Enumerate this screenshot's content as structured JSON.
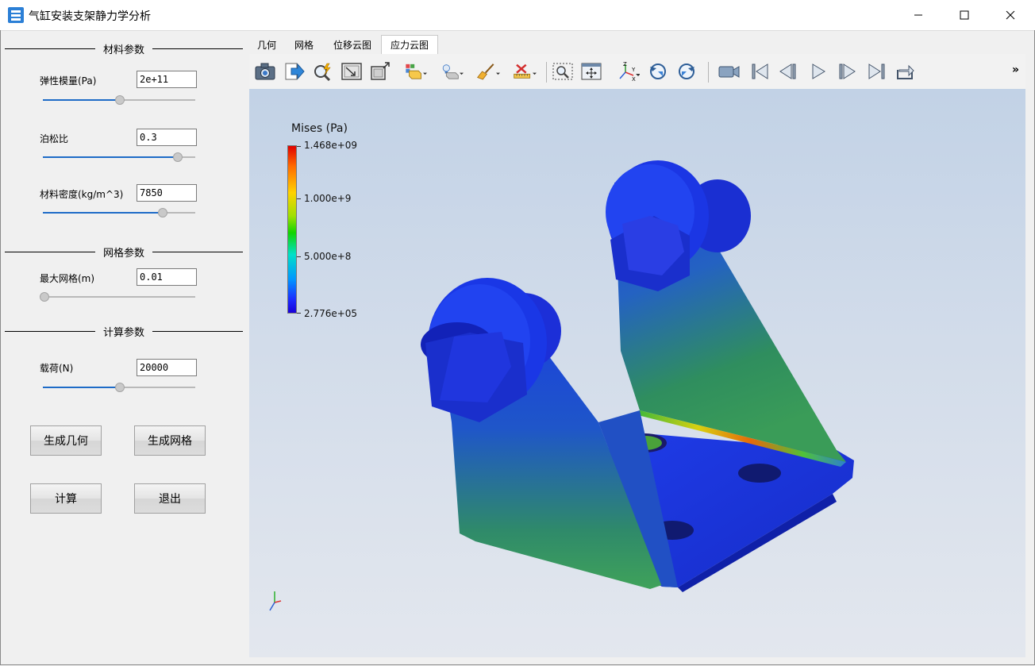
{
  "window": {
    "title": "气缸安装支架静力学分析"
  },
  "sections": {
    "material": "材料参数",
    "mesh": "网格参数",
    "calc": "计算参数"
  },
  "params": {
    "elastic": {
      "label": "弹性模量(Pa)",
      "value": "2e+11",
      "slider_fraction": 0.5
    },
    "poisson": {
      "label": "泊松比",
      "value": "0.3",
      "slider_fraction": 0.88
    },
    "density": {
      "label": "材料密度(kg/m^3)",
      "value": "7850",
      "slider_fraction": 0.78
    },
    "mesh_size": {
      "label": "最大网格(m)",
      "value": "0.01",
      "slider_fraction": 0.0
    },
    "load": {
      "label": "载荷(N)",
      "value": "20000",
      "slider_fraction": 0.5
    }
  },
  "buttons": {
    "gen_geometry": "生成几何",
    "gen_mesh": "生成网格",
    "compute": "计算",
    "exit": "退出"
  },
  "tabs": [
    "几何",
    "网格",
    "位移云图",
    "应力云图"
  ],
  "active_tab": "应力云图",
  "toolbar": {
    "more": "»"
  },
  "colorbar": {
    "title": "Mises (Pa)",
    "max": "1.468e+09",
    "mid_high": "1.000e+9",
    "mid_low": "5.000e+8",
    "min": "2.776e+05"
  }
}
